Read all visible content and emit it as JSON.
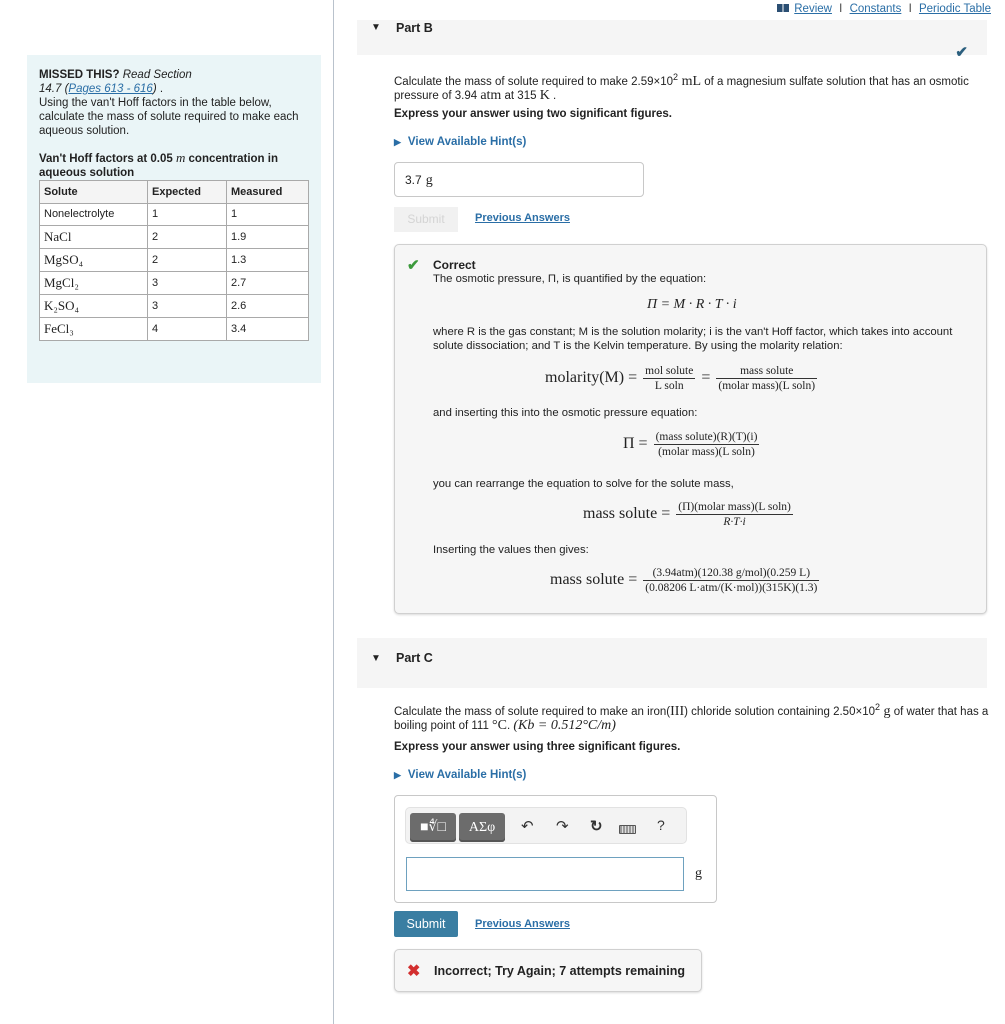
{
  "top_links": {
    "review": "Review",
    "constants": "Constants",
    "periodic_table": "Periodic Table",
    "separator": "I"
  },
  "left_panel": {
    "missed_label": "MISSED THIS?",
    "read_section": "Read Section 14.7 (",
    "pages_link": "Pages 613 - 616",
    "after_link": ") .",
    "instructions": "Using the van't Hoff factors in the table below, calculate the mass of solute required to make each aqueous solution.",
    "table_title_a": "Van't Hoff factors at 0.05 ",
    "table_title_m": "m",
    "table_title_b": " concentration in aqueous solution",
    "headers": [
      "Solute",
      "Expected",
      "Measured"
    ],
    "rows": [
      {
        "solute": "Nonelectrolyte",
        "expected": "1",
        "measured": "1",
        "formula": false
      },
      {
        "solute": "NaCl",
        "expected": "2",
        "measured": "1.9",
        "formula": true
      },
      {
        "solute": "MgSO₄",
        "expected": "2",
        "measured": "1.3",
        "formula": true
      },
      {
        "solute": "MgCl₂",
        "expected": "3",
        "measured": "2.7",
        "formula": true
      },
      {
        "solute": "K₂SO₄",
        "expected": "3",
        "measured": "2.6",
        "formula": true
      },
      {
        "solute": "FeCl₃",
        "expected": "4",
        "measured": "3.4",
        "formula": true
      }
    ]
  },
  "part_b": {
    "title": "Part B",
    "status_icon": "check-icon",
    "question_a": "Calculate the mass of solute required to make 2.59×10",
    "question_exp": "2",
    "question_unit1": " mL",
    "question_b": " of a magnesium sulfate solution that has an osmotic pressure of 3.94 ",
    "question_unit2": "atm",
    "question_c": " at 315 ",
    "question_unit3": "K",
    "question_d": " .",
    "sig_figs": "Express your answer using two significant figures.",
    "hint": "View Available Hint(s)",
    "answer_value": "3.7",
    "answer_unit": "g",
    "submit": "Submit",
    "previous_answers": "Previous Answers",
    "feedback": {
      "title": "Correct",
      "line1": "The osmotic pressure, Π, is quantified by the equation:",
      "eq1": "Π = M · R · T · i",
      "line2": "where R is the gas constant; M is the solution molarity; i is the van't Hoff factor, which takes into account solute dissociation; and T is the Kelvin temperature. By using the molarity relation:",
      "eq2_lhs": "molarity(M) =",
      "eq2_f1_num": "mol solute",
      "eq2_f1_den": "L soln",
      "eq2_mid": "=",
      "eq2_f2_num": "mass solute",
      "eq2_f2_den": "(molar mass)(L soln)",
      "line3": "and inserting this into the osmotic pressure equation:",
      "eq3_lhs": "Π =",
      "eq3_num": "(mass solute)(R)(T)(i)",
      "eq3_den": "(molar mass)(L soln)",
      "line4": "you can rearrange the equation to solve for the solute mass,",
      "eq4_lhs": "mass solute =",
      "eq4_num": "(Π)(molar mass)(L soln)",
      "eq4_den": "R·T·i",
      "line5": "Inserting the values then gives:",
      "eq5_lhs": "mass solute =",
      "eq5_num": "(3.94atm)(120.38 g/mol)(0.259 L)",
      "eq5_den": "(0.08206 L·atm/(K·mol))(315K)(1.3)"
    }
  },
  "part_c": {
    "title": "Part C",
    "question_a": "Calculate the mass of solute required to make an iron(",
    "question_roman": "III",
    "question_b": ") chloride solution containing 2.50×10",
    "question_exp": "2",
    "question_unit1": " g",
    "question_c": " of water that has a boiling point of 111 ",
    "question_unit2": "°C",
    "question_d": ". ",
    "question_kb": "(Kb = 0.512°C/m)",
    "sig_figs": "Express your answer using three significant figures.",
    "hint": "View Available Hint(s)",
    "toolbar": {
      "templates": "■∜□",
      "symbols": "ΑΣφ",
      "undo": "↶",
      "redo": "↷",
      "reset": "↻",
      "help": "?"
    },
    "answer_value": "",
    "answer_unit": "g",
    "submit": "Submit",
    "previous_answers": "Previous Answers",
    "feedback": "Incorrect; Try Again; 7 attempts remaining"
  },
  "colors": {
    "link": "#2a6ea6",
    "submit_bg": "#3a7ea2",
    "correct": "#3c9a3c",
    "incorrect": "#d32f2f",
    "panel_bg": "#eaf5f7"
  }
}
